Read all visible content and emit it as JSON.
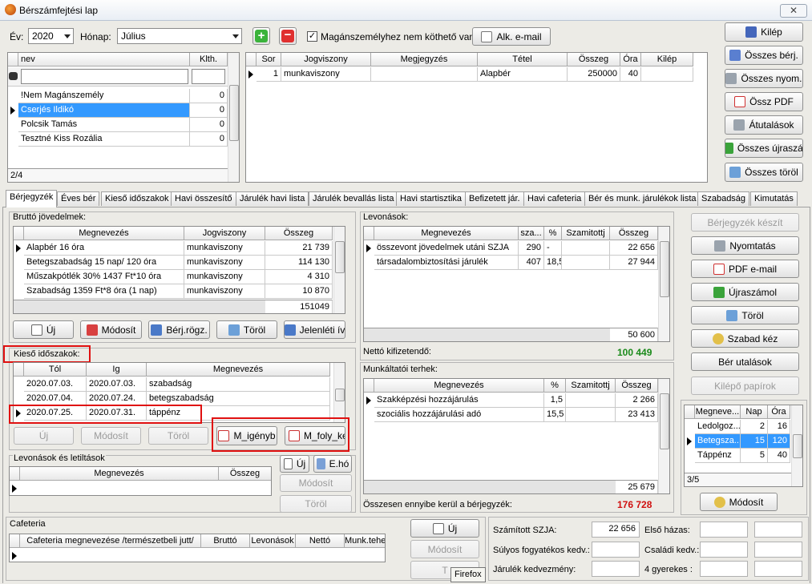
{
  "window": {
    "title": "Bérszámfejtési lap",
    "close": "✕"
  },
  "toolbar": {
    "year_label": "Év:",
    "year": "2020",
    "month_label": "Hónap:",
    "month": "Július",
    "checkbox_label": "Magánszemélyhez nem köthető van",
    "email_button": "Alk. e-mail"
  },
  "right_buttons": [
    "Kilép",
    "Összes bérj.",
    "Összes nyom.",
    "Össz PDF",
    "Átutalások",
    "Összes újraszá.",
    "Összes töröl"
  ],
  "persons": {
    "headers": [
      "nev",
      "Klth."
    ],
    "rows": [
      [
        "!Nem Magánszemély",
        "0"
      ],
      [
        "Cserjés Ildikó",
        "0"
      ],
      [
        "Polcsik Tamás",
        "0"
      ],
      [
        "Tesztné Kiss Rozália",
        "0"
      ]
    ],
    "footer": "2/4"
  },
  "jobs": {
    "headers": [
      "Sor",
      "Jogviszony",
      "Megjegyzés",
      "Tétel",
      "Összeg",
      "Óra",
      "Kilép"
    ],
    "rows": [
      [
        "1",
        "munkaviszony",
        "",
        "Alapbér",
        "250000",
        "40",
        ""
      ]
    ]
  },
  "tabs": [
    "Bérjegyzék",
    "Éves bér",
    "Kieső időszakok",
    "Havi összesítő",
    "Járulék havi lista",
    "Járulék bevallás lista",
    "Havi startisztika",
    "Befizetett jár.",
    "Havi cafeteria",
    "Bér és munk. járulékok lista",
    "Szabadság",
    "Kimutatás"
  ],
  "gross": {
    "title": "Bruttó jövedelmek:",
    "headers": [
      "Megnevezés",
      "Jogviszony",
      "Összeg"
    ],
    "rows": [
      [
        "Alapbér 16 óra",
        "munkaviszony",
        "21 739"
      ],
      [
        "Betegszabadság 15 nap/ 120 óra",
        "munkaviszony",
        "114 130"
      ],
      [
        "Műszakpótlék 30% 1437 Ft*10 óra",
        "munkaviszony",
        "4 310"
      ],
      [
        "Szabadság 1359 Ft*8 óra (1 nap)",
        "munkaviszony",
        "10 870"
      ]
    ],
    "total": "151049",
    "buttons": [
      "Új",
      "Módosít",
      "Bérj.rögz.",
      "Töröl",
      "Jelenléti ív"
    ]
  },
  "absence": {
    "title": "Kieső időszakok:",
    "headers": [
      "Tól",
      "Ig",
      "Megnevezés"
    ],
    "rows": [
      [
        "2020.07.03.",
        "2020.07.03.",
        "szabadság"
      ],
      [
        "2020.07.04.",
        "2020.07.24.",
        "betegszabadság"
      ],
      [
        "2020.07.25.",
        "2020.07.31.",
        "táppénz"
      ]
    ],
    "buttons": [
      "Új",
      "Módosít",
      "Töröl"
    ],
    "extra_buttons": [
      "M_igényb",
      "M_foly_ker"
    ]
  },
  "deductions_left": {
    "title": "Levonások és letiltások",
    "headers": [
      "Megnevezés",
      "Összeg"
    ],
    "buttons": [
      "Új",
      "E.hó",
      "Módosít",
      "Töröl"
    ]
  },
  "deductions": {
    "title": "Levonások:",
    "headers": [
      "Megnevezés",
      "sza...",
      "%",
      "Szamitottj",
      "Összeg"
    ],
    "rows": [
      [
        "összevont jövedelmek utáni SZJA",
        "290",
        "-",
        "",
        "22 656"
      ],
      [
        "társadalombiztosítási járulék",
        "407",
        "18,5",
        "",
        "27 944"
      ]
    ],
    "total": "50 600",
    "net_label": "Nettó kifizetendő:",
    "net_value": "100 449"
  },
  "employer": {
    "title": "Munkáltatói terhek:",
    "headers": [
      "Megnevezés",
      "%",
      "Szamitottj",
      "Összeg"
    ],
    "rows": [
      [
        "Szakképzési hozzájárulás",
        "1,5",
        "",
        "2 266"
      ],
      [
        "szociális hozzájárulási adó",
        "15,5",
        "",
        "23 413"
      ]
    ],
    "total": "25 679",
    "sum_label": "Összesen ennyibe kerül a bérjegyzék:",
    "sum_value": "176 728"
  },
  "action_buttons": [
    "Bérjegyzék készít",
    "Nyomtatás",
    "PDF e-mail",
    "Újraszámol",
    "Töröl",
    "Szabad kéz",
    "Bér utalások",
    "Kilépő papírok"
  ],
  "leave": {
    "headers": [
      "Megneve...",
      "Nap",
      "Óra"
    ],
    "rows": [
      [
        "Ledolgoz...",
        "2",
        "16"
      ],
      [
        "Betegsza...",
        "15",
        "120"
      ],
      [
        "Táppénz",
        "5",
        "40"
      ]
    ],
    "footer": "3/5",
    "button": "Módosít"
  },
  "cafeteria": {
    "title": "Cafeteria",
    "headers": [
      "Cafeteria megnevezése /természetbeli jutt/",
      "Bruttó",
      "Levonások",
      "Nettó",
      "Munk.teher"
    ],
    "buttons": [
      "Új",
      "Módosít",
      "T"
    ],
    "tooltip": "Firefox"
  },
  "summary": {
    "szja_label": "Számított SZJA:",
    "szja_value": "22 656",
    "elso_label": "Első házas:",
    "sulyos_label": "Súlyos fogyatékos kedv.:",
    "csaladi_label": "Családi kedv.:",
    "jarulek_label": "Járulék kedvezmény:",
    "gyerek_label": "4 gyerekes :"
  },
  "colors": {
    "selection": "#3399ff",
    "net": "#1a8a1a",
    "total": "#d01010",
    "highlight": "#e01010"
  }
}
